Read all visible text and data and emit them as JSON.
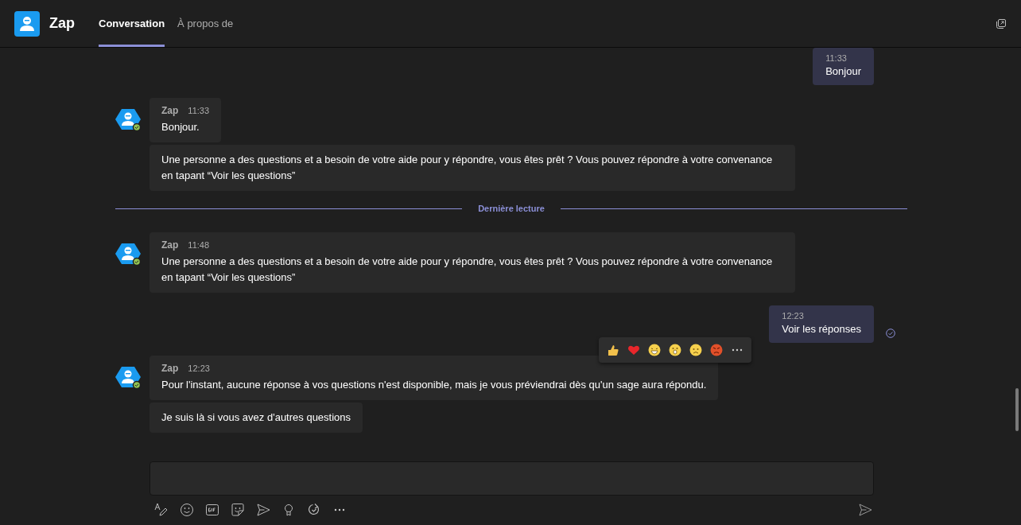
{
  "app": {
    "name": "Zap"
  },
  "tabs": [
    {
      "label": "Conversation",
      "selected": true
    },
    {
      "label": "À propos de",
      "selected": false
    }
  ],
  "messages": [
    {
      "kind": "outgoing",
      "time": "11:33",
      "text": "Bonjour",
      "read": false,
      "reactions_shown": false
    },
    {
      "kind": "incoming",
      "sender": "Zap",
      "time": "11:33",
      "bubbles": [
        "Bonjour.",
        "Une personne a des questions et a besoin de votre aide pour y répondre, vous êtes prêt ? Vous pouvez répondre à votre convenance en tapant “Voir les questions”"
      ]
    },
    {
      "kind": "divider",
      "label": "Dernière lecture"
    },
    {
      "kind": "incoming",
      "sender": "Zap",
      "time": "11:48",
      "bubbles": [
        "Une personne a des questions et a besoin de votre aide pour y répondre, vous êtes prêt ? Vous pouvez répondre à votre convenance en tapant “Voir les questions”"
      ]
    },
    {
      "kind": "outgoing",
      "time": "12:23",
      "text": "Voir les réponses",
      "read": true,
      "reactions_shown": true
    },
    {
      "kind": "incoming",
      "sender": "Zap",
      "time": "12:23",
      "bubbles": [
        "Pour l'instant, aucune réponse à vos questions n'est disponible, mais je vous préviendrai dès qu'un sage aura répondu.",
        "Je suis là si vous avez d'autres questions"
      ]
    }
  ]
}
